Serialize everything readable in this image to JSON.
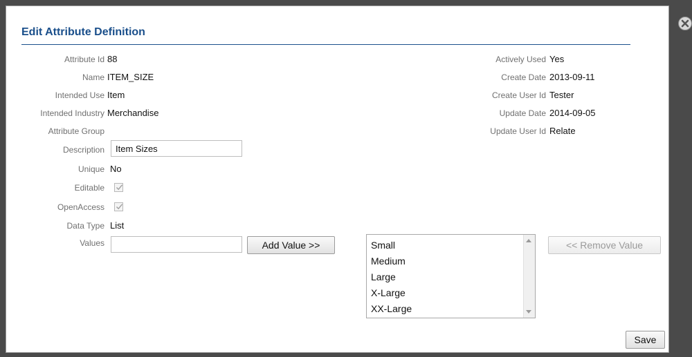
{
  "dialog": {
    "title": "Edit Attribute Definition"
  },
  "left_fields": [
    {
      "label": "Attribute Id",
      "value": "88"
    },
    {
      "label": "Name",
      "value": "ITEM_SIZE"
    },
    {
      "label": "Intended Use",
      "value": "Item"
    },
    {
      "label": "Intended Industry",
      "value": "Merchandise"
    },
    {
      "label": "Attribute Group",
      "value": ""
    }
  ],
  "description": {
    "label": "Description",
    "value": "Item Sizes"
  },
  "unique": {
    "label": "Unique",
    "value": "No"
  },
  "editable": {
    "label": "Editable",
    "checked": true
  },
  "open_access": {
    "label": "OpenAccess",
    "checked": true
  },
  "data_type": {
    "label": "Data Type",
    "value": "List"
  },
  "values": {
    "label": "Values",
    "input_value": "",
    "add_button": "Add Value >>",
    "remove_button": "<< Remove Value",
    "list_items": [
      "Small",
      "Medium",
      "Large",
      "X-Large",
      "XX-Large"
    ]
  },
  "right_fields": [
    {
      "label": "Actively Used",
      "value": "Yes"
    },
    {
      "label": "Create Date",
      "value": "2013-09-11"
    },
    {
      "label": "Create User Id",
      "value": "Tester"
    },
    {
      "label": "Update Date",
      "value": "2014-09-05"
    },
    {
      "label": "Update User Id",
      "value": "Relate"
    }
  ],
  "save_button": "Save",
  "colors": {
    "title": "#1a4f8b",
    "label": "#707070",
    "backdrop": "#4a4a4a"
  }
}
